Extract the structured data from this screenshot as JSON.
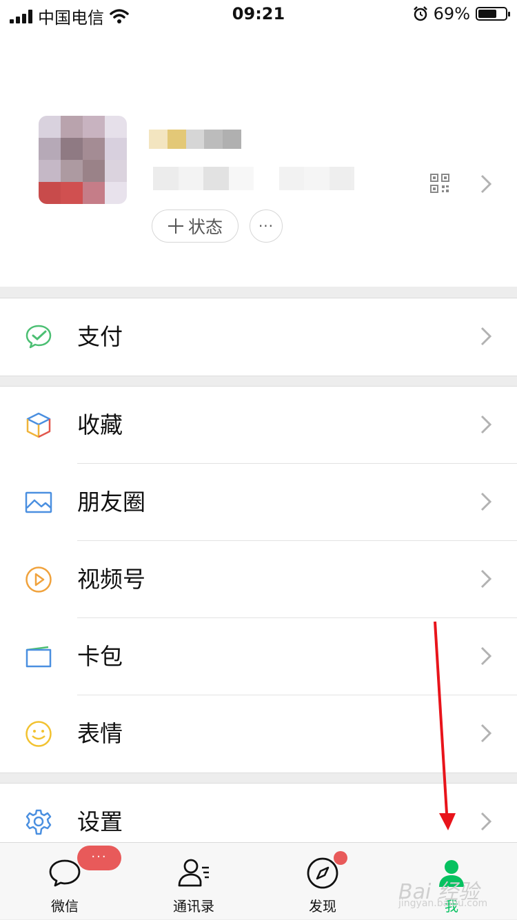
{
  "status_bar": {
    "carrier": "中国电信",
    "time": "09:21",
    "battery": "69%",
    "battery_level": 0.69
  },
  "profile": {
    "status_button": "状态",
    "more_button": "···"
  },
  "menu_groups": [
    {
      "items": [
        {
          "label": "支付",
          "icon": "wechat-pay-icon"
        }
      ]
    },
    {
      "items": [
        {
          "label": "收藏",
          "icon": "favorites-cube-icon"
        },
        {
          "label": "朋友圈",
          "icon": "moments-image-icon"
        },
        {
          "label": "视频号",
          "icon": "channels-play-icon"
        },
        {
          "label": "卡包",
          "icon": "card-wallet-icon"
        },
        {
          "label": "表情",
          "icon": "sticker-smiley-icon"
        }
      ]
    },
    {
      "items": [
        {
          "label": "设置",
          "icon": "settings-gear-icon"
        }
      ]
    }
  ],
  "tab_bar": {
    "tabs": [
      {
        "label": "微信",
        "icon": "chat-bubble-icon",
        "badge": "···"
      },
      {
        "label": "通讯录",
        "icon": "contacts-icon"
      },
      {
        "label": "发现",
        "icon": "compass-icon"
      },
      {
        "label": "我",
        "icon": "me-person-icon"
      }
    ]
  },
  "watermark": {
    "text": "Bai 经验",
    "sub": "jingyan.baidu.com"
  },
  "colors": {
    "accent_green": "#07c160",
    "badge_red": "#e85a5a",
    "annotation_arrow": "#e8141b"
  }
}
